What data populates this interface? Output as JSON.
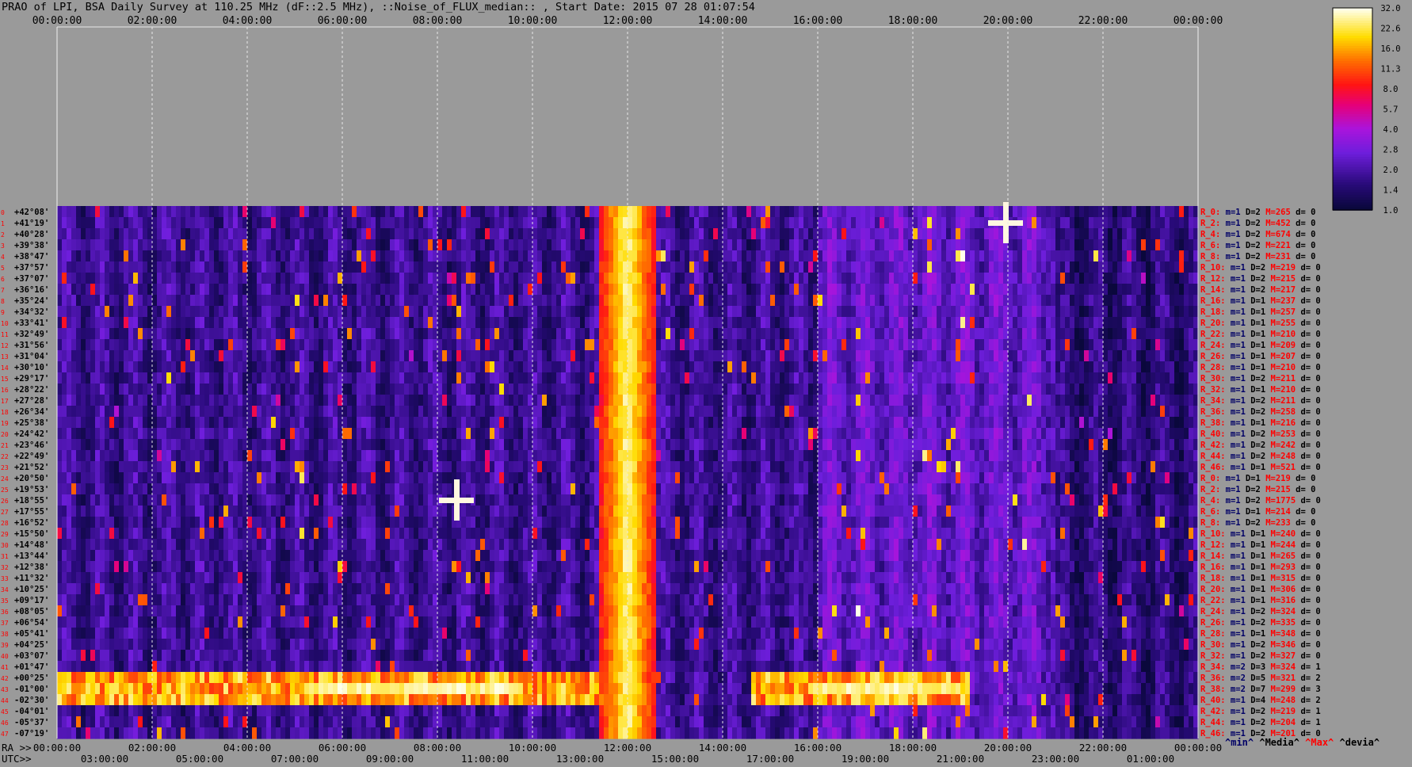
{
  "title": "PRAO of LPI, BSA Daily Survey at 110.25 MHz (dF::2.5 MHz), ::Noise_of_FLUX_median:: , Start Date: 2015 07 28 01:07:54",
  "colors": {
    "background": "#9a9a9a",
    "heatmap_low": "#0a0840",
    "heatmap_mid": "#7a22dd",
    "heatmap_high": "#ffffff",
    "stat_red": "#ff0000",
    "stat_navy": "#000066"
  },
  "chart_data": {
    "type": "heatmap",
    "top_axis_ticks": [
      "00:00:00",
      "02:00:00",
      "04:00:00",
      "06:00:00",
      "08:00:00",
      "10:00:00",
      "12:00:00",
      "14:00:00",
      "16:00:00",
      "18:00:00",
      "20:00:00",
      "22:00:00",
      "00:00:00"
    ],
    "bottom_axis_row1_ticks": [
      "00:00:00",
      "02:00:00",
      "04:00:00",
      "06:00:00",
      "08:00:00",
      "10:00:00",
      "12:00:00",
      "14:00:00",
      "16:00:00",
      "18:00:00",
      "20:00:00",
      "22:00:00",
      "00:00:00"
    ],
    "bottom_axis_row2_ticks": [
      "03:00:00",
      "05:00:00",
      "07:00:00",
      "09:00:00",
      "11:00:00",
      "13:00:00",
      "15:00:00",
      "17:00:00",
      "19:00:00",
      "21:00:00",
      "23:00:00",
      "01:00:00"
    ],
    "bottom_axis_row1_label": "RA >>",
    "bottom_axis_row2_label": "UTC>>",
    "colorbar_ticks": [
      "32.0",
      "22.6",
      "16.0",
      "11.3",
      "8.0",
      "5.7",
      "4.0",
      "2.8",
      "2.0",
      "1.4",
      "1.0"
    ],
    "dec_labels": [
      "+42°08'",
      "+41°19'",
      "+40°28'",
      "+39°38'",
      "+38°47'",
      "+37°57'",
      "+37°07'",
      "+36°16'",
      "+35°24'",
      "+34°32'",
      "+33°41'",
      "+32°49'",
      "+31°56'",
      "+31°04'",
      "+30°10'",
      "+29°17'",
      "+28°22'",
      "+27°28'",
      "+26°34'",
      "+25°38'",
      "+24°42'",
      "+23°46'",
      "+22°49'",
      "+21°52'",
      "+20°50'",
      "+19°53'",
      "+18°55'",
      "+17°55'",
      "+16°52'",
      "+15°50'",
      "+14°48'",
      "+13°44'",
      "+12°38'",
      "+11°32'",
      "+10°25'",
      "+09°17'",
      "+08°05'",
      "+06°54'",
      "+05°41'",
      "+04°25'",
      "+03°07'",
      "+01°47'",
      "+00°25'",
      "-01°00'",
      "-02°30'",
      "-04°01'",
      "-05°37'",
      "-07°19'"
    ],
    "row_indices": [
      0,
      1,
      2,
      3,
      4,
      5,
      6,
      7,
      8,
      9,
      10,
      11,
      12,
      13,
      14,
      15,
      16,
      17,
      18,
      19,
      20,
      21,
      22,
      23,
      24,
      25,
      26,
      27,
      28,
      29,
      30,
      31,
      32,
      33,
      34,
      35,
      36,
      37,
      38,
      39,
      40,
      41,
      42,
      43,
      44,
      45,
      46,
      47
    ],
    "stats": [
      {
        "r": "R_0:",
        "m": "m=1",
        "d": "D=2",
        "M": "M=265",
        "dev": "d= 0"
      },
      {
        "r": "R_2:",
        "m": "m=1",
        "d": "D=2",
        "M": "M=452",
        "dev": "d= 0"
      },
      {
        "r": "R_4:",
        "m": "m=1",
        "d": "D=2",
        "M": "M=674",
        "dev": "d= 0"
      },
      {
        "r": "R_6:",
        "m": "m=1",
        "d": "D=2",
        "M": "M=221",
        "dev": "d= 0"
      },
      {
        "r": "R_8:",
        "m": "m=1",
        "d": "D=2",
        "M": "M=231",
        "dev": "d= 0"
      },
      {
        "r": "R_10:",
        "m": "m=1",
        "d": "D=2",
        "M": "M=219",
        "dev": "d= 0"
      },
      {
        "r": "R_12:",
        "m": "m=1",
        "d": "D=2",
        "M": "M=215",
        "dev": "d= 0"
      },
      {
        "r": "R_14:",
        "m": "m=1",
        "d": "D=2",
        "M": "M=217",
        "dev": "d= 0"
      },
      {
        "r": "R_16:",
        "m": "m=1",
        "d": "D=1",
        "M": "M=237",
        "dev": "d= 0"
      },
      {
        "r": "R_18:",
        "m": "m=1",
        "d": "D=1",
        "M": "M=257",
        "dev": "d= 0"
      },
      {
        "r": "R_20:",
        "m": "m=1",
        "d": "D=1",
        "M": "M=255",
        "dev": "d= 0"
      },
      {
        "r": "R_22:",
        "m": "m=1",
        "d": "D=1",
        "M": "M=210",
        "dev": "d= 0"
      },
      {
        "r": "R_24:",
        "m": "m=1",
        "d": "D=1",
        "M": "M=209",
        "dev": "d= 0"
      },
      {
        "r": "R_26:",
        "m": "m=1",
        "d": "D=1",
        "M": "M=207",
        "dev": "d= 0"
      },
      {
        "r": "R_28:",
        "m": "m=1",
        "d": "D=1",
        "M": "M=210",
        "dev": "d= 0"
      },
      {
        "r": "R_30:",
        "m": "m=1",
        "d": "D=2",
        "M": "M=211",
        "dev": "d= 0"
      },
      {
        "r": "R_32:",
        "m": "m=1",
        "d": "D=1",
        "M": "M=210",
        "dev": "d= 0"
      },
      {
        "r": "R_34:",
        "m": "m=1",
        "d": "D=2",
        "M": "M=211",
        "dev": "d= 0"
      },
      {
        "r": "R_36:",
        "m": "m=1",
        "d": "D=2",
        "M": "M=258",
        "dev": "d= 0"
      },
      {
        "r": "R_38:",
        "m": "m=1",
        "d": "D=1",
        "M": "M=216",
        "dev": "d= 0"
      },
      {
        "r": "R_40:",
        "m": "m=1",
        "d": "D=2",
        "M": "M=253",
        "dev": "d= 0"
      },
      {
        "r": "R_42:",
        "m": "m=1",
        "d": "D=2",
        "M": "M=242",
        "dev": "d= 0"
      },
      {
        "r": "R_44:",
        "m": "m=1",
        "d": "D=2",
        "M": "M=248",
        "dev": "d= 0"
      },
      {
        "r": "R_46:",
        "m": "m=1",
        "d": "D=1",
        "M": "M=521",
        "dev": "d= 0"
      },
      {
        "r": "R_0:",
        "m": "m=1",
        "d": "D=1",
        "M": "M=219",
        "dev": "d= 0"
      },
      {
        "r": "R_2:",
        "m": "m=1",
        "d": "D=2",
        "M": "M=215",
        "dev": "d= 0"
      },
      {
        "r": "R_4:",
        "m": "m=1",
        "d": "D=2",
        "M": "M=1775",
        "dev": "d= 0"
      },
      {
        "r": "R_6:",
        "m": "m=1",
        "d": "D=1",
        "M": "M=214",
        "dev": "d= 0"
      },
      {
        "r": "R_8:",
        "m": "m=1",
        "d": "D=2",
        "M": "M=233",
        "dev": "d= 0"
      },
      {
        "r": "R_10:",
        "m": "m=1",
        "d": "D=1",
        "M": "M=240",
        "dev": "d= 0"
      },
      {
        "r": "R_12:",
        "m": "m=1",
        "d": "D=1",
        "M": "M=244",
        "dev": "d= 0"
      },
      {
        "r": "R_14:",
        "m": "m=1",
        "d": "D=1",
        "M": "M=265",
        "dev": "d= 0"
      },
      {
        "r": "R_16:",
        "m": "m=1",
        "d": "D=1",
        "M": "M=293",
        "dev": "d= 0"
      },
      {
        "r": "R_18:",
        "m": "m=1",
        "d": "D=1",
        "M": "M=315",
        "dev": "d= 0"
      },
      {
        "r": "R_20:",
        "m": "m=1",
        "d": "D=1",
        "M": "M=306",
        "dev": "d= 0"
      },
      {
        "r": "R_22:",
        "m": "m=1",
        "d": "D=1",
        "M": "M=316",
        "dev": "d= 0"
      },
      {
        "r": "R_24:",
        "m": "m=1",
        "d": "D=2",
        "M": "M=324",
        "dev": "d= 0"
      },
      {
        "r": "R_26:",
        "m": "m=1",
        "d": "D=2",
        "M": "M=335",
        "dev": "d= 0"
      },
      {
        "r": "R_28:",
        "m": "m=1",
        "d": "D=1",
        "M": "M=348",
        "dev": "d= 0"
      },
      {
        "r": "R_30:",
        "m": "m=1",
        "d": "D=2",
        "M": "M=346",
        "dev": "d= 0"
      },
      {
        "r": "R_32:",
        "m": "m=1",
        "d": "D=2",
        "M": "M=327",
        "dev": "d= 0"
      },
      {
        "r": "R_34:",
        "m": "m=2",
        "d": "D=3",
        "M": "M=324",
        "dev": "d= 1"
      },
      {
        "r": "R_36:",
        "m": "m=2",
        "d": "D=5",
        "M": "M=321",
        "dev": "d= 2"
      },
      {
        "r": "R_38:",
        "m": "m=2",
        "d": "D=7",
        "M": "M=299",
        "dev": "d= 3"
      },
      {
        "r": "R_40:",
        "m": "m=1",
        "d": "D=4",
        "M": "M=248",
        "dev": "d= 2"
      },
      {
        "r": "R_42:",
        "m": "m=1",
        "d": "D=2",
        "M": "M=219",
        "dev": "d= 1"
      },
      {
        "r": "R_44:",
        "m": "m=1",
        "d": "D=2",
        "M": "M=204",
        "dev": "d= 1"
      },
      {
        "r": "R_46:",
        "m": "m=1",
        "d": "D=2",
        "M": "M=201",
        "dev": "d= 0"
      }
    ],
    "stats_legend": [
      {
        "text": "^min^",
        "color": "#000066"
      },
      {
        "text": "^Media^",
        "color": "#000000"
      },
      {
        "text": "^Max^",
        "color": "#ff0000"
      },
      {
        "text": "^devia^",
        "color": "#000000"
      }
    ],
    "bright_vertical_band_ra_hours": [
      11.4,
      12.6
    ],
    "bright_horizontal_band_dec_rows": [
      42,
      44
    ]
  }
}
